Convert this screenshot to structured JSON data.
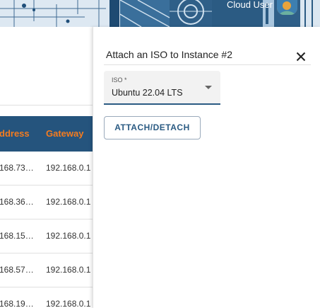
{
  "header": {
    "user_name": "Cloud User"
  },
  "table": {
    "columns": [
      "ddress",
      "Gateway"
    ],
    "rows": [
      {
        "address": "168.73…",
        "gateway": "192.168.0.1"
      },
      {
        "address": "168.36…",
        "gateway": "192.168.0.1"
      },
      {
        "address": "168.15…",
        "gateway": "192.168.0.1"
      },
      {
        "address": "168.57…",
        "gateway": "192.168.0.1"
      },
      {
        "address": "168.19…",
        "gateway": "192.168.0.1"
      }
    ]
  },
  "drawer": {
    "title": "Attach an ISO to Instance #2",
    "iso_select": {
      "label": "ISO *",
      "value": "Ubuntu 22.04 LTS"
    },
    "action_label": "ATTACH/DETACH"
  },
  "colors": {
    "header_bg": "#2f5f88",
    "table_header_bg": "#25547d",
    "column_header_text": "#f57c1f",
    "accent": "#2b5b83"
  },
  "icons": {
    "close": "close-icon",
    "caret": "chevron-down-icon"
  }
}
